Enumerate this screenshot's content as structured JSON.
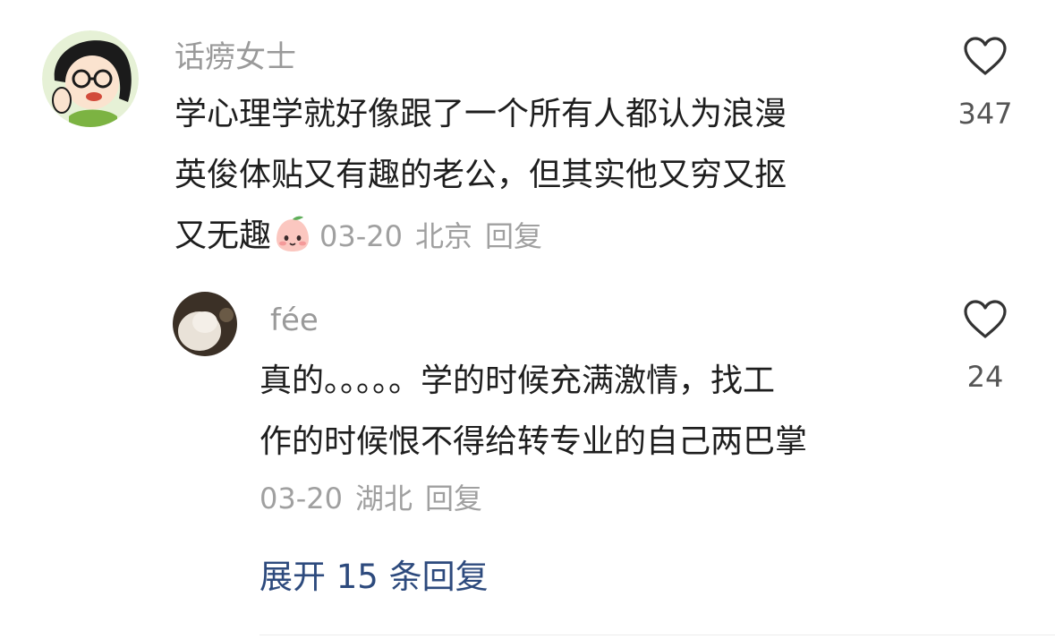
{
  "comment": {
    "username": "话痨女士",
    "text_lines": [
      "学心理学就好像跟了一个所有人都认为浪漫",
      "英俊体贴又有趣的老公，但其实他又穷又抠",
      "又无趣"
    ],
    "date": "03-20",
    "location": "北京",
    "reply_label": "回复",
    "likes": "347",
    "emoji": "peach-face-emoji"
  },
  "reply": {
    "username": "fée",
    "text_lines": [
      "真的。。。。。学的时候充满激情，找工",
      "作的时候恨不得给转专业的自己两巴掌"
    ],
    "date": "03-20",
    "location": "湖北",
    "reply_label": "回复",
    "likes": "24"
  },
  "expand_label": "展开 15 条回复",
  "colors": {
    "username": "#9a9a9a",
    "meta": "#a0a0a0",
    "link": "#2d4a7d"
  }
}
